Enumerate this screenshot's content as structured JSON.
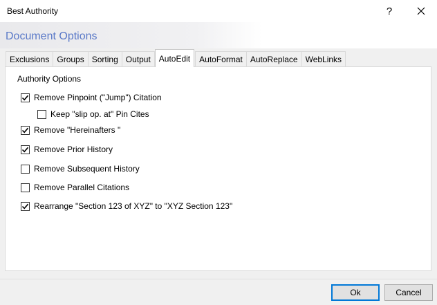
{
  "window": {
    "title": "Best Authority",
    "help_glyph": "?",
    "close_icon": "close-icon"
  },
  "header": {
    "title": "Document Options",
    "title_color": "#5a79c8"
  },
  "tabs": [
    {
      "label": "Exclusions",
      "active": false
    },
    {
      "label": "Groups",
      "active": false
    },
    {
      "label": "Sorting",
      "active": false
    },
    {
      "label": "Output",
      "active": false
    },
    {
      "label": "AutoEdit",
      "active": true
    },
    {
      "label": "AutoFormat",
      "active": false
    },
    {
      "label": "AutoReplace",
      "active": false
    },
    {
      "label": "WebLinks",
      "active": false
    }
  ],
  "authority_options": {
    "legend": "Authority Options",
    "items": [
      {
        "label": "Remove Pinpoint (\"Jump\") Citation",
        "checked": true
      },
      {
        "label": "Keep \"slip op. at\" Pin Cites",
        "checked": false
      },
      {
        "label": "Remove \"Hereinafters \"",
        "checked": true
      },
      {
        "label": "Remove Prior History",
        "checked": true
      },
      {
        "label": "Remove Subsequent History",
        "checked": false
      },
      {
        "label": "Remove Parallel Citations",
        "checked": false
      },
      {
        "label": "Rearrange \"Section 123 of XYZ\" to \"XYZ Section 123\"",
        "checked": true
      }
    ]
  },
  "footer": {
    "ok_label": "Ok",
    "cancel_label": "Cancel"
  }
}
